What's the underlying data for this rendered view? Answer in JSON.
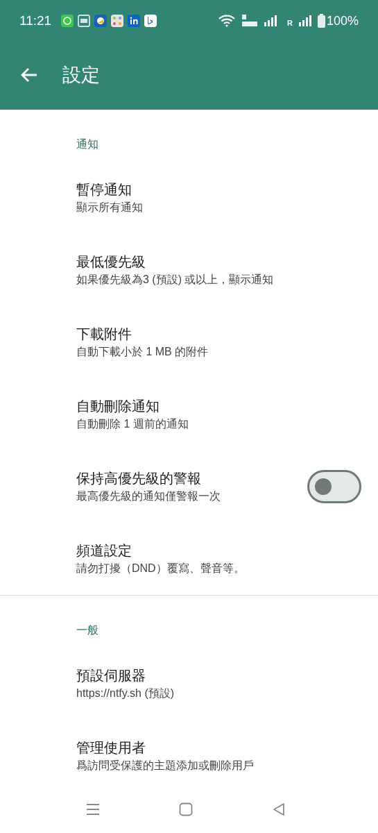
{
  "status_bar": {
    "time": "11:21",
    "battery": "100%",
    "network_label": "R"
  },
  "app_bar": {
    "title": "設定"
  },
  "sections": [
    {
      "label": "通知",
      "items": [
        {
          "kind": "plain",
          "title": "暫停通知",
          "subtitle": "顯示所有通知"
        },
        {
          "kind": "plain",
          "title": "最低優先級",
          "subtitle": "如果優先級為3 (預設) 或以上，顯示通知"
        },
        {
          "kind": "plain",
          "title": "下載附件",
          "subtitle": "自動下載小於 1 MB 的附件"
        },
        {
          "kind": "plain",
          "title": "自動刪除通知",
          "subtitle": "自動刪除 1 週前的通知"
        },
        {
          "kind": "toggle",
          "title": "保持高優先級的警報",
          "subtitle": "最高優先級的通知僅警報一次",
          "on": false
        },
        {
          "kind": "plain",
          "title": "頻道設定",
          "subtitle": "請勿打擾（DND）覆寫、聲音等。"
        }
      ]
    },
    {
      "label": "一般",
      "items": [
        {
          "kind": "plain",
          "title": "預設伺服器",
          "subtitle": "https://ntfy.sh (預設)"
        },
        {
          "kind": "plain",
          "title": "管理使用者",
          "subtitle": "爲訪問受保護的主題添加或刪除用戶"
        }
      ]
    }
  ]
}
